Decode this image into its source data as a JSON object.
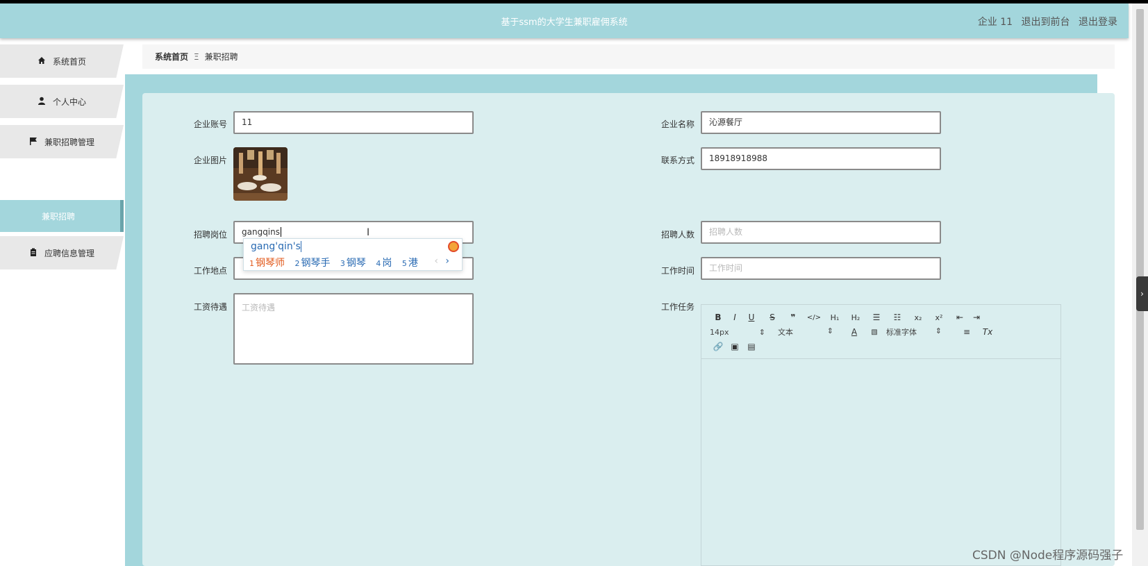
{
  "header": {
    "title": "基于ssm的大学生兼职雇佣系统",
    "user": "企业 11",
    "to_front": "退出到前台",
    "logout": "退出登录"
  },
  "sidebar": {
    "items": [
      {
        "label": "系统首页",
        "icon": "home-icon"
      },
      {
        "label": "个人中心",
        "icon": "user-icon"
      },
      {
        "label": "兼职招聘管理",
        "icon": "flag-icon"
      },
      {
        "label": "应聘信息管理",
        "icon": "clipboard-icon"
      }
    ],
    "active_sub": "兼职招聘"
  },
  "breadcrumb": {
    "home": "系统首页",
    "separator": "Ξ",
    "current": "兼职招聘"
  },
  "form": {
    "company_account": {
      "label": "企业账号",
      "value": "11"
    },
    "company_name": {
      "label": "企业名称",
      "value": "沁源餐厅"
    },
    "company_image": {
      "label": "企业图片"
    },
    "contact": {
      "label": "联系方式",
      "value": "18918918988"
    },
    "position": {
      "label": "招聘岗位",
      "value": "gangqins"
    },
    "headcount": {
      "label": "招聘人数",
      "placeholder": "招聘人数"
    },
    "location": {
      "label": "工作地点"
    },
    "work_time": {
      "label": "工作时间",
      "placeholder": "工作时间"
    },
    "salary": {
      "label": "工资待遇",
      "placeholder": "工资待遇"
    },
    "task": {
      "label": "工作任务"
    }
  },
  "ime": {
    "pinyin": "gang'qin's",
    "candidates": [
      {
        "n": "1",
        "text": "钢琴师"
      },
      {
        "n": "2",
        "text": "钢琴手"
      },
      {
        "n": "3",
        "text": "钢琴"
      },
      {
        "n": "4",
        "text": "岗"
      },
      {
        "n": "5",
        "text": "港"
      }
    ],
    "prev": "‹",
    "next": "›"
  },
  "editor": {
    "font_size": "14px",
    "block_type": "文本",
    "font_family": "标准字体"
  },
  "watermark": "CSDN @Node程序源码强子",
  "colors": {
    "header_bg": "#a3d6dc",
    "panel_bg": "#daeeef",
    "ime_highlight": "#e25a1c"
  }
}
